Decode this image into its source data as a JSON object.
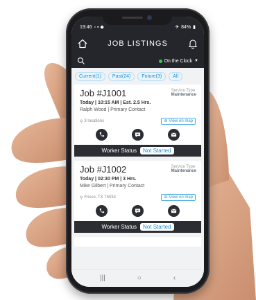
{
  "status": {
    "time": "19:46",
    "battery": "84%"
  },
  "header": {
    "title": "JOB LISTINGS"
  },
  "clock": {
    "label": "On the Clock"
  },
  "tabs": [
    {
      "label": "Current(1)"
    },
    {
      "label": "Past(24)"
    },
    {
      "label": "Future(3)"
    },
    {
      "label": "All"
    }
  ],
  "jobs": [
    {
      "title": "Job #J1001",
      "service_label": "Service Type",
      "service_value": "Maintenance",
      "schedule": "Today | 10:15 AM | Est. 2.5 Hrs.",
      "contact": "Ralph Wood | Primary Contact",
      "location": "3 locations",
      "map_label": "View on map",
      "worker_label": "Worker Status",
      "worker_status": "Not Started"
    },
    {
      "title": "Job #J1002",
      "service_label": "Service Type",
      "service_value": "Maintenance",
      "schedule": "Today | 02:30 PM | 3 Hrs.",
      "contact": "Mike Gilbert | Primary Contact",
      "location": "Frisco, TX 75034",
      "map_label": "View on map",
      "worker_label": "Worker Status",
      "worker_status": "Not Started"
    }
  ],
  "icons": {
    "home": "home-icon",
    "bell": "bell-icon",
    "search": "search-icon",
    "phone": "phone-icon",
    "chat": "chat-icon",
    "mail": "mail-icon",
    "pin": "pin-icon",
    "map": "map-target-icon"
  },
  "colors": {
    "accent": "#1f8ed6",
    "dark": "#24262b",
    "online": "#3cc95b"
  }
}
